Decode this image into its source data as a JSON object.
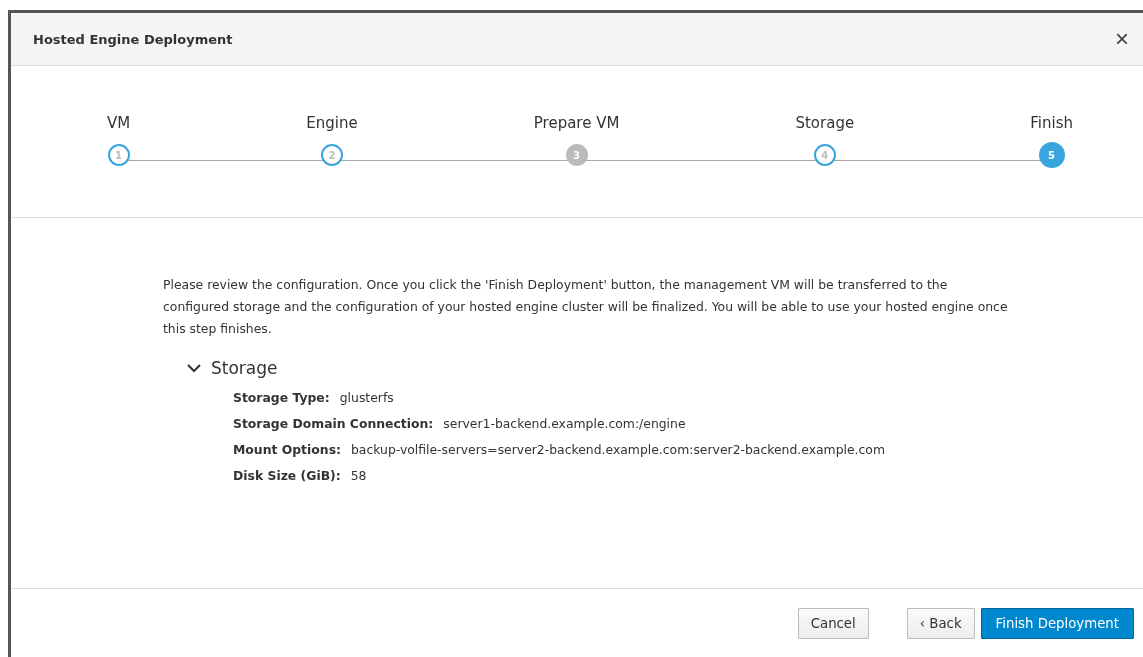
{
  "window": {
    "title": "Hosted Engine Deployment",
    "close": "×"
  },
  "steps": [
    {
      "label": "VM",
      "number": "1",
      "selected": false,
      "disabled": false
    },
    {
      "label": "Engine",
      "number": "2",
      "selected": false,
      "disabled": false
    },
    {
      "label": "Prepare VM",
      "number": "3",
      "selected": false,
      "disabled": true
    },
    {
      "label": "Storage",
      "number": "4",
      "selected": false,
      "disabled": false
    },
    {
      "label": "Finish",
      "number": "5",
      "selected": true,
      "disabled": false
    }
  ],
  "intro": "Please review the configuration. Once you click the 'Finish Deployment' button, the management VM will be transferred to the configured storage and the configuration of your hosted engine cluster will be finalized. You will be able to use your hosted engine once this step finishes.",
  "section": {
    "title": "Storage",
    "expanded": true,
    "fields": [
      {
        "label": "Storage Type:",
        "value": "glusterfs"
      },
      {
        "label": "Storage Domain Connection:",
        "value": "server1-backend.example.com:/engine"
      },
      {
        "label": "Mount Options:",
        "value": "backup-volfile-servers=server2-backend.example.com:server2-backend.example.com"
      },
      {
        "label": "Disk Size (GiB):",
        "value": "58"
      }
    ]
  },
  "buttons": [
    {
      "label": "Cancel",
      "kind": "default"
    },
    {
      "label": "‹ Back",
      "kind": "default"
    },
    {
      "label": "Finish Deployment",
      "kind": "primary"
    }
  ]
}
